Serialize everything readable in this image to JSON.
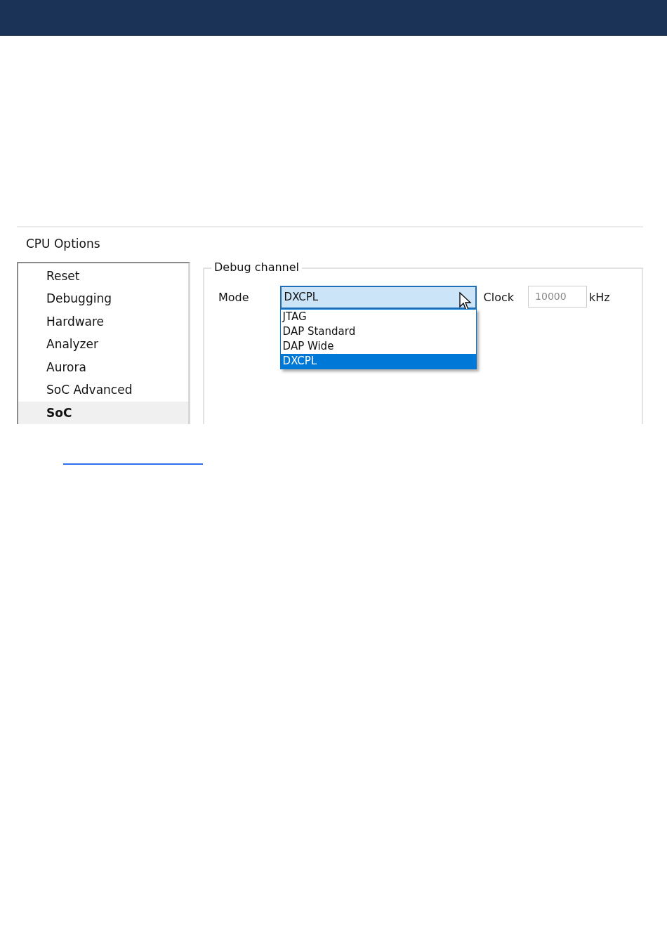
{
  "panel": {
    "title": "CPU Options"
  },
  "categories": [
    {
      "label": "Reset",
      "selected": false
    },
    {
      "label": "Debugging",
      "selected": false
    },
    {
      "label": "Hardware",
      "selected": false
    },
    {
      "label": "Analyzer",
      "selected": false
    },
    {
      "label": "Aurora",
      "selected": false
    },
    {
      "label": "SoC Advanced",
      "selected": false
    },
    {
      "label": "SoC",
      "selected": true
    }
  ],
  "debug_channel": {
    "title": "Debug channel",
    "mode_label": "Mode",
    "mode_value": "DXCPL",
    "expanded": true,
    "options": [
      {
        "label": "JTAG",
        "selected": false
      },
      {
        "label": "DAP Standard",
        "selected": false
      },
      {
        "label": "DAP Wide",
        "selected": false
      },
      {
        "label": "DXCPL",
        "selected": true
      }
    ],
    "clock_label": "Clock",
    "clock_value": "10000",
    "clock_unit": "kHz",
    "clock_disabled": true
  }
}
